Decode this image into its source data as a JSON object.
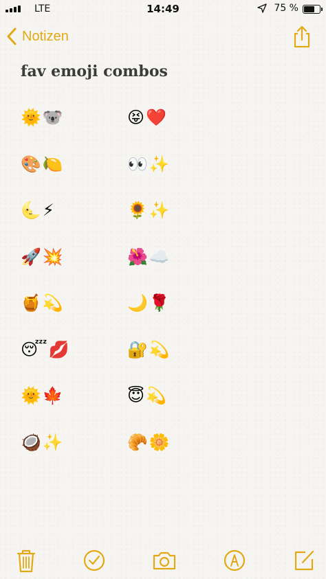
{
  "status_bar": {
    "carrier": "LTE",
    "time": "14:49",
    "battery": "75 %",
    "battery_level": 0.75,
    "signal_icon": "cellular-signal-icon",
    "location_icon": "location-arrow-icon"
  },
  "nav": {
    "back_label": "Notizen",
    "back_icon": "chevron-left-icon",
    "share_icon": "share-icon"
  },
  "note": {
    "title": "fav emoji combos",
    "rows": [
      {
        "left": "🌞🐨",
        "right": "😝❤️"
      },
      {
        "left": "🎨🍋",
        "right": "👀✨"
      },
      {
        "left": "🌜⚡",
        "right": "🌻✨"
      },
      {
        "left": "🚀💥",
        "right": "🌺☁️"
      },
      {
        "left": "🍯💫",
        "right": "🌙🌹"
      },
      {
        "left": "😴💋",
        "right": "🔐💫"
      },
      {
        "left": "🌞🍁",
        "right": "😇💫"
      },
      {
        "left": "🥥✨",
        "right": "🥐🌼"
      }
    ]
  },
  "toolbar": {
    "items": [
      "trash-icon",
      "checklist-icon",
      "camera-icon",
      "markup-icon",
      "compose-icon"
    ]
  },
  "colors": {
    "accent": "#e1a914",
    "paper": "#f6f5f2",
    "title_text": "#3b3b3b"
  }
}
